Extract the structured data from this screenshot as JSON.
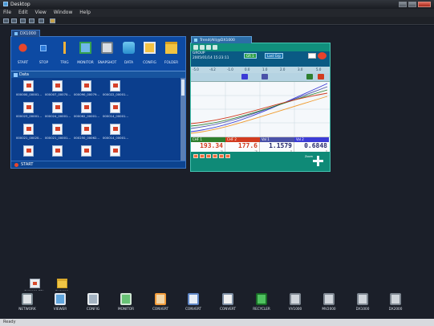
{
  "app": {
    "title": "Desktop"
  },
  "menu": [
    "File",
    "Edit",
    "View",
    "Window",
    "Help"
  ],
  "dx_window": {
    "tab": "DX1000",
    "tools": [
      "START",
      "STOP",
      "TRIG",
      "MONITOR",
      "SNAPSHOT",
      "DATA",
      "CONFIG",
      "FOLDER"
    ],
    "data_label": "Data",
    "files": [
      [
        "000000_00001...",
        "000007_00070...",
        "000090_00079...",
        "000022_00001..."
      ],
      [
        "000023_00001...",
        "000024_00001...",
        "000062_00001...",
        "000014_00001..."
      ],
      [
        "000021_00020...",
        "000021_00001...",
        "000250_00062...",
        "000014_00001..."
      ]
    ],
    "status": "START"
  },
  "trend_window": {
    "tab": "Trend(All)@DX1000",
    "info_line1": "GROUP",
    "info_line2": "2005/01/14 15:23:11",
    "badge1": "GR 1",
    "badge2": "Last Grp",
    "scale_ticks": [
      "-5.0",
      "-4.2",
      "-1.0",
      "0.0",
      "1.0",
      "2.0",
      "3.0",
      "5.0"
    ],
    "channels": [
      {
        "tag": "CHF 1",
        "value": "193.34",
        "unit": "°C",
        "color": "#2e7f2e"
      },
      {
        "tag": "CHF 2",
        "value": "177.6",
        "unit": "°C",
        "color": "#d23b1f"
      },
      {
        "tag": "Val 1",
        "value": "1.1579",
        "unit": "V",
        "color": "#4b52a8"
      },
      {
        "tag": "Val 2",
        "value": "0.6848",
        "unit": "V",
        "color": "#3b3bd6"
      }
    ],
    "zoom_label": "Zoom"
  },
  "desktop_shortcuts": [
    "DX1000-PDL",
    "DX1000"
  ],
  "dock": [
    "NETWORK",
    "VIEWER",
    "CONFIG",
    "MONITOR",
    "CONVERT",
    "CONVERT",
    "CONVERT",
    "RECYCLER",
    "VV1000",
    "MV2000",
    "DX1000",
    "DX2000"
  ],
  "status_text": "Ready",
  "colors": {
    "dx_blue": "#0a3d8c",
    "trend_teal": "#0f8a77"
  }
}
